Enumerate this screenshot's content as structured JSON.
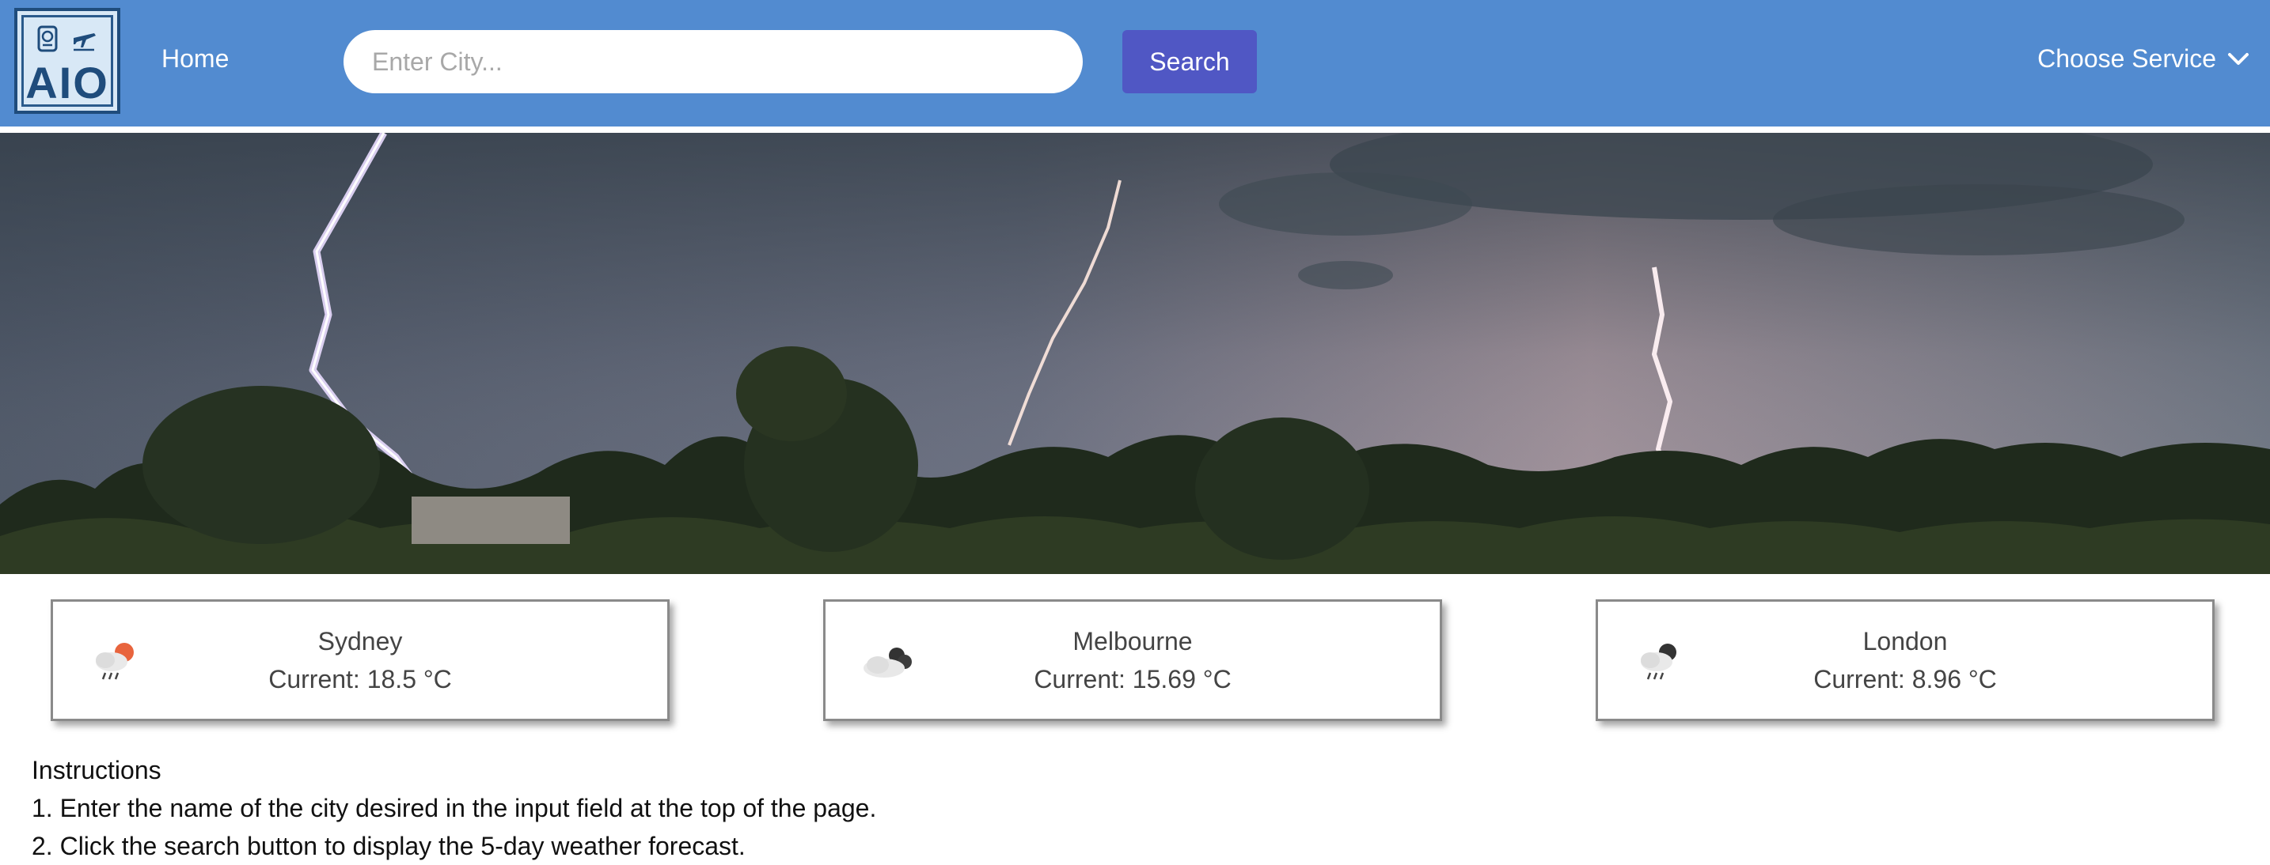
{
  "navbar": {
    "logo_text": "AIO",
    "logo_icons": [
      "passport-icon",
      "airplane-icon"
    ],
    "home_label": "Home",
    "search": {
      "placeholder": "Enter City...",
      "value": ""
    },
    "search_button_label": "Search",
    "service_dropdown_label": "Choose Service"
  },
  "hero": {
    "image": "lightning-storm-over-trees"
  },
  "weather_cards": [
    {
      "city": "Sydney",
      "current": "Current: 18.5 °C",
      "icon": "sun-cloud-rain-icon"
    },
    {
      "city": "Melbourne",
      "current": "Current: 15.69 °C",
      "icon": "moon-cloud-icon"
    },
    {
      "city": "London",
      "current": "Current: 8.96 °C",
      "icon": "moon-cloud-rain-icon"
    }
  ],
  "instructions": {
    "heading": "Instructions",
    "steps": [
      "1. Enter the name of the city desired in the input field at the top of the page.",
      "2. Click the search button to display the 5-day weather forecast."
    ]
  },
  "colors": {
    "navbar_bg": "#528bd0",
    "search_button_bg": "#5057c4",
    "logo_dark": "#1f4c7c"
  }
}
